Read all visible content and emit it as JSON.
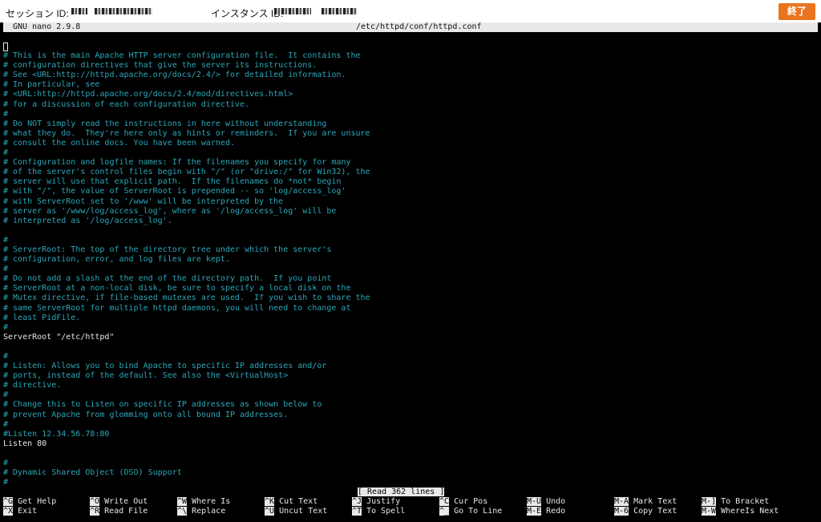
{
  "session_bar": {
    "session_label": "セッション ID:",
    "instance_label": "インスタンス ID:",
    "end_button": "終了",
    "accent": "#e8741f"
  },
  "nano": {
    "version": "GNU nano 2.9.8",
    "filename": "/etc/httpd/conf/httpd.conf",
    "status_message": "[ Read 362 lines ]"
  },
  "editor": {
    "lines": [
      {
        "text": "",
        "comment": false
      },
      {
        "text": "# This is the main Apache HTTP server configuration file.  It contains the",
        "comment": true
      },
      {
        "text": "# configuration directives that give the server its instructions.",
        "comment": true
      },
      {
        "text": "# See <URL:http://httpd.apache.org/docs/2.4/> for detailed information.",
        "comment": true
      },
      {
        "text": "# In particular, see",
        "comment": true
      },
      {
        "text": "# <URL:http://httpd.apache.org/docs/2.4/mod/directives.html>",
        "comment": true
      },
      {
        "text": "# for a discussion of each configuration directive.",
        "comment": true
      },
      {
        "text": "#",
        "comment": true
      },
      {
        "text": "# Do NOT simply read the instructions in here without understanding",
        "comment": true
      },
      {
        "text": "# what they do.  They're here only as hints or reminders.  If you are unsure",
        "comment": true
      },
      {
        "text": "# consult the online docs. You have been warned.",
        "comment": true
      },
      {
        "text": "#",
        "comment": true
      },
      {
        "text": "# Configuration and logfile names: If the filenames you specify for many",
        "comment": true
      },
      {
        "text": "# of the server's control files begin with \"/\" (or \"drive:/\" for Win32), the",
        "comment": true
      },
      {
        "text": "# server will use that explicit path.  If the filenames do *not* begin",
        "comment": true
      },
      {
        "text": "# with \"/\", the value of ServerRoot is prepended -- so 'log/access_log'",
        "comment": true
      },
      {
        "text": "# with ServerRoot set to '/www' will be interpreted by the",
        "comment": true
      },
      {
        "text": "# server as '/www/log/access_log', where as '/log/access_log' will be",
        "comment": true
      },
      {
        "text": "# interpreted as '/log/access_log'.",
        "comment": true
      },
      {
        "text": "",
        "comment": false
      },
      {
        "text": "#",
        "comment": true
      },
      {
        "text": "# ServerRoot: The top of the directory tree under which the server's",
        "comment": true
      },
      {
        "text": "# configuration, error, and log files are kept.",
        "comment": true
      },
      {
        "text": "#",
        "comment": true
      },
      {
        "text": "# Do not add a slash at the end of the directory path.  If you point",
        "comment": true
      },
      {
        "text": "# ServerRoot at a non-local disk, be sure to specify a local disk on the",
        "comment": true
      },
      {
        "text": "# Mutex directive, if file-based mutexes are used.  If you wish to share the",
        "comment": true
      },
      {
        "text": "# same ServerRoot for multiple httpd daemons, you will need to change at",
        "comment": true
      },
      {
        "text": "# least PidFile.",
        "comment": true
      },
      {
        "text": "#",
        "comment": true
      },
      {
        "text": "ServerRoot \"/etc/httpd\"",
        "comment": false
      },
      {
        "text": "",
        "comment": false
      },
      {
        "text": "#",
        "comment": true
      },
      {
        "text": "# Listen: Allows you to bind Apache to specific IP addresses and/or",
        "comment": true
      },
      {
        "text": "# ports, instead of the default. See also the <VirtualHost>",
        "comment": true
      },
      {
        "text": "# directive.",
        "comment": true
      },
      {
        "text": "#",
        "comment": true
      },
      {
        "text": "# Change this to Listen on specific IP addresses as shown below to",
        "comment": true
      },
      {
        "text": "# prevent Apache from glomming onto all bound IP addresses.",
        "comment": true
      },
      {
        "text": "#",
        "comment": true
      },
      {
        "text": "#Listen 12.34.56.78:80",
        "comment": true
      },
      {
        "text": "Listen 80",
        "comment": false
      },
      {
        "text": "",
        "comment": false
      },
      {
        "text": "#",
        "comment": true
      },
      {
        "text": "# Dynamic Shared Object (DSO) Support",
        "comment": true
      },
      {
        "text": "#",
        "comment": true
      }
    ]
  },
  "shortcuts": [
    [
      {
        "key": "^G",
        "label": "Get Help"
      },
      {
        "key": "^O",
        "label": "Write Out"
      },
      {
        "key": "^W",
        "label": "Where Is"
      },
      {
        "key": "^K",
        "label": "Cut Text"
      },
      {
        "key": "^J",
        "label": "Justify"
      },
      {
        "key": "^C",
        "label": "Cur Pos"
      },
      {
        "key": "M-U",
        "label": "Undo"
      },
      {
        "key": "M-A",
        "label": "Mark Text"
      },
      {
        "key": "M-]",
        "label": "To Bracket"
      }
    ],
    [
      {
        "key": "^X",
        "label": "Exit"
      },
      {
        "key": "^R",
        "label": "Read File"
      },
      {
        "key": "^\\",
        "label": "Replace"
      },
      {
        "key": "^U",
        "label": "Uncut Text"
      },
      {
        "key": "^T",
        "label": "To Spell"
      },
      {
        "key": "^_",
        "label": "Go To Line"
      },
      {
        "key": "M-E",
        "label": "Redo"
      },
      {
        "key": "M-6",
        "label": "Copy Text"
      },
      {
        "key": "M-W",
        "label": "WhereIs Next"
      }
    ]
  ],
  "colors": {
    "comment": "#2aa7b8",
    "text": "#e8e8e8",
    "background": "#000000",
    "inverse": "#e9e9e9"
  }
}
